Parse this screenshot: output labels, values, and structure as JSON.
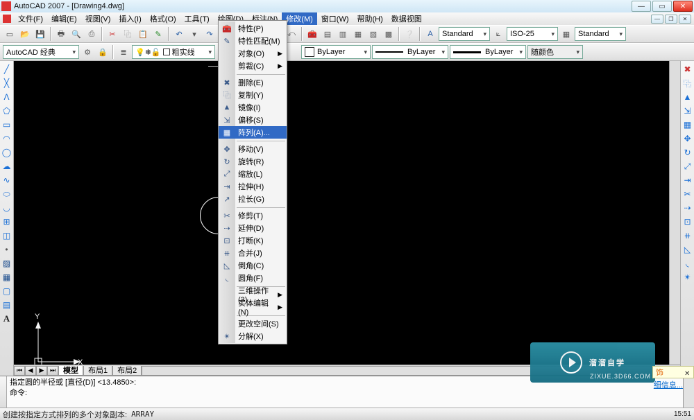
{
  "window": {
    "title": "AutoCAD 2007 - [Drawing4.dwg]"
  },
  "menubar": [
    {
      "label": "文件(F)"
    },
    {
      "label": "编辑(E)"
    },
    {
      "label": "视图(V)"
    },
    {
      "label": "插入(I)"
    },
    {
      "label": "格式(O)"
    },
    {
      "label": "工具(T)"
    },
    {
      "label": "绘图(D)"
    },
    {
      "label": "标注(N)"
    },
    {
      "label": "修改(M)",
      "open": true
    },
    {
      "label": "窗口(W)"
    },
    {
      "label": "帮助(H)"
    },
    {
      "label": "数据视图"
    }
  ],
  "toolbar1": {
    "style_label": "Standard",
    "dimstyle_label": "ISO-25",
    "tablestyle_label": "Standard"
  },
  "toolbar2": {
    "workspace": "AutoCAD 经典",
    "linetype_label": "粗实线",
    "color_label": "ByLayer",
    "linetype2_label": "ByLayer",
    "lineweight_label": "ByLayer",
    "plotstyle_label": "随颜色"
  },
  "dropdown": {
    "items": [
      {
        "icon": "🧰",
        "label": "特性(P)"
      },
      {
        "icon": "✎",
        "label": "特性匹配(M)"
      },
      {
        "icon": "",
        "label": "对象(O)",
        "sub": true
      },
      {
        "icon": "",
        "label": "剪裁(C)",
        "sub": true
      },
      {
        "sep": true
      },
      {
        "icon": "✖",
        "label": "删除(E)"
      },
      {
        "icon": "⿻",
        "label": "复制(Y)"
      },
      {
        "icon": "▲",
        "label": "镜像(I)"
      },
      {
        "icon": "⇲",
        "label": "偏移(S)"
      },
      {
        "icon": "▦",
        "label": "阵列(A)...",
        "selected": true
      },
      {
        "sep": true
      },
      {
        "icon": "✥",
        "label": "移动(V)"
      },
      {
        "icon": "↻",
        "label": "旋转(R)"
      },
      {
        "icon": "⤢",
        "label": "缩放(L)"
      },
      {
        "icon": "⇥",
        "label": "拉伸(H)"
      },
      {
        "icon": "↗",
        "label": "拉长(G)"
      },
      {
        "sep": true
      },
      {
        "icon": "✂",
        "label": "修剪(T)"
      },
      {
        "icon": "⇢",
        "label": "延伸(D)"
      },
      {
        "icon": "⊡",
        "label": "打断(K)"
      },
      {
        "icon": "⧺",
        "label": "合并(J)"
      },
      {
        "icon": "◺",
        "label": "倒角(C)"
      },
      {
        "icon": "◟",
        "label": "圆角(F)"
      },
      {
        "sep": true
      },
      {
        "icon": "",
        "label": "三维操作(3)",
        "sub": true
      },
      {
        "icon": "",
        "label": "实体编辑(N)",
        "sub": true
      },
      {
        "sep": true
      },
      {
        "icon": "",
        "label": "更改空间(S)"
      },
      {
        "icon": "✴",
        "label": "分解(X)"
      }
    ]
  },
  "tabs": {
    "model": "模型",
    "layout1": "布局1",
    "layout2": "布局2"
  },
  "cmd": {
    "line1": "指定圆的半径或 [直径(D)] <13.4850>:",
    "line2": "命令:"
  },
  "status": {
    "text": "创建按指定方式排列的多个对象副本:",
    "cmd": "ARRAY",
    "clock": "15:51"
  },
  "ucs": {
    "x": "X",
    "y": "Y"
  },
  "watermark": {
    "brand": "溜溜自学",
    "url": "ZIXUE.3D66.COM"
  },
  "tooltip": {
    "text": "饰",
    "link": "细信息..."
  }
}
